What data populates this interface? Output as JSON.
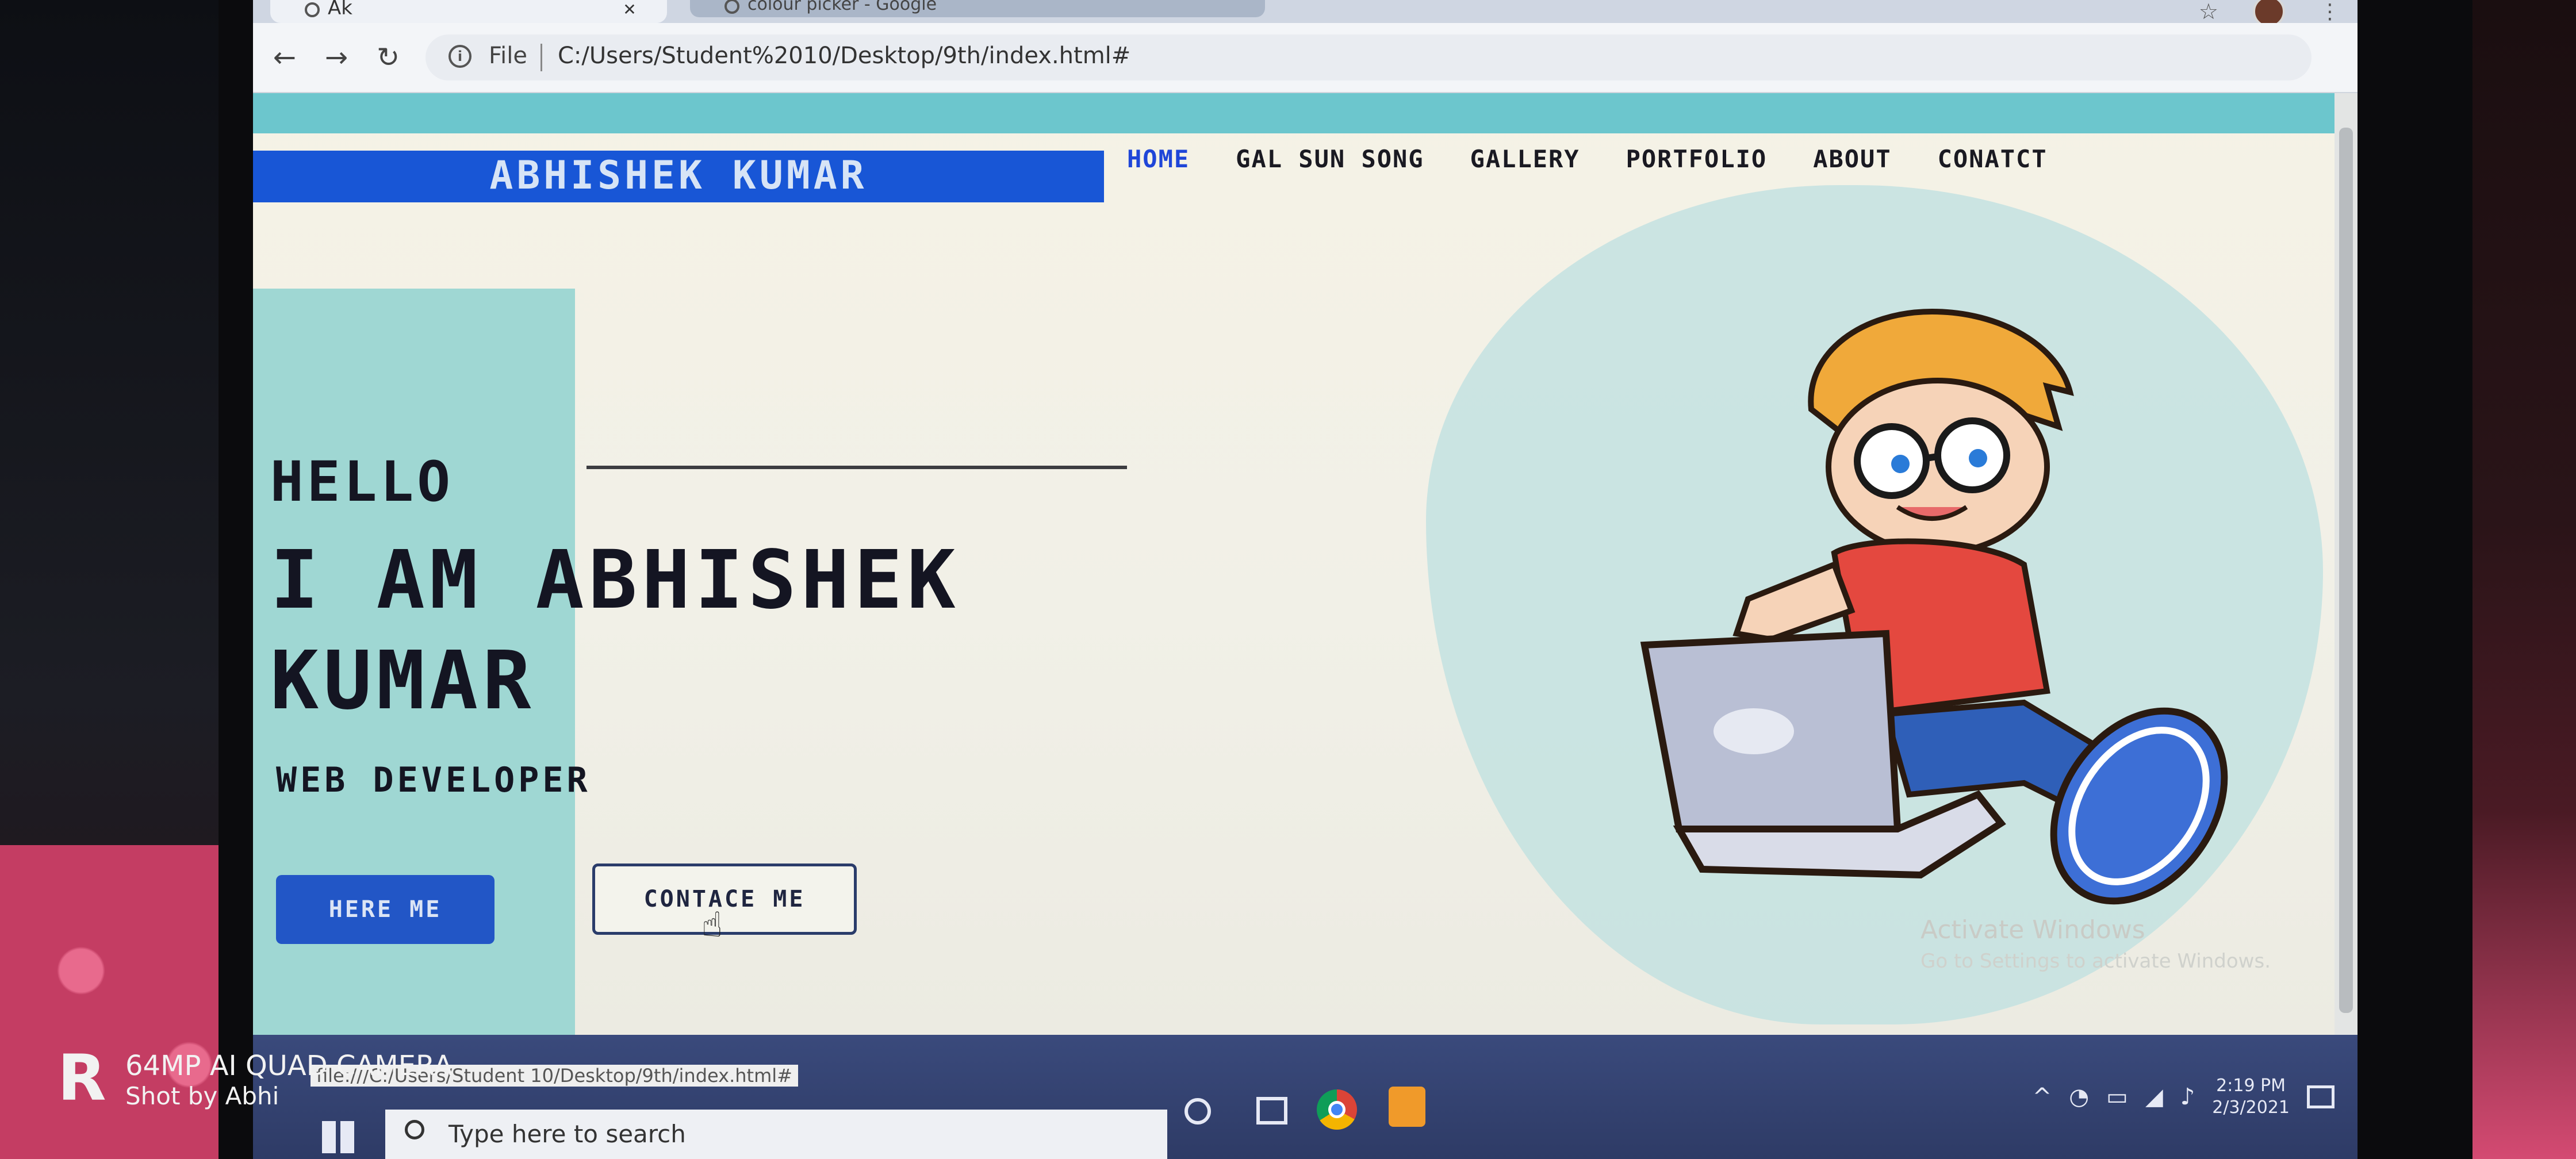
{
  "browser": {
    "tab_title": "Ak",
    "tab_title_2": "colour picker - Google",
    "file_label": "File",
    "url": "C:/Users/Student%2010/Desktop/9th/index.html#"
  },
  "site": {
    "brand": "ABHISHEK KUMAR",
    "nav": [
      "HOME",
      "GAL SUN SONG",
      "GALLERY",
      "PORTFOLIO",
      "ABOUT",
      "CONATCT"
    ],
    "active_nav": "HOME",
    "hello": "HELLO",
    "headline": "I AM ABHISHEK KUMAR",
    "role": "WEB DEVELOPER",
    "hire_button": "HERE ME",
    "contact_button": "CONTACE ME",
    "status_url": "file:///C:/Users/Student 10/Desktop/9th/index.html#",
    "watermark_1": "Activate Windows",
    "watermark_2": "Go to Settings to activate Windows."
  },
  "taskbar": {
    "search_placeholder": "Type here to search",
    "time": "2:19 PM",
    "date": "2/3/2021"
  },
  "camera": {
    "logo": "R",
    "line1": "64MP AI QUAD CAMERA",
    "line2": "Shot by Abhi"
  },
  "colors": {
    "brand_blue": "#1856d6",
    "teal": "#6cc6cd",
    "active_nav": "#1f46d8"
  },
  "icons": [
    "star-icon",
    "kebab-icon",
    "back-icon",
    "forward-icon",
    "reload-icon",
    "info-icon",
    "cursor-icon",
    "windows-start-icon",
    "search-icon",
    "cortana-icon",
    "taskview-icon",
    "chrome-icon",
    "sublime-icon",
    "notification-icon"
  ]
}
